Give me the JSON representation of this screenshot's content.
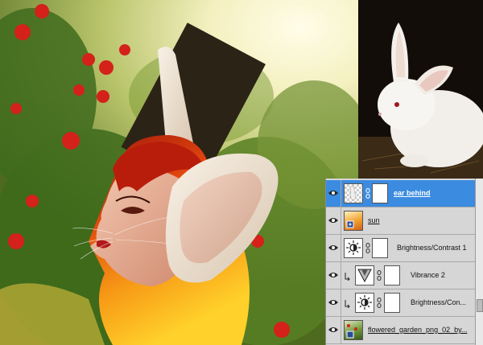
{
  "layers": [
    {
      "name": "ear behind",
      "selected": true,
      "has_mask": true,
      "clipped": false,
      "kind": "pixel-transparent"
    },
    {
      "name": "sun",
      "selected": false,
      "has_mask": false,
      "clipped": false,
      "kind": "pixel-sun"
    },
    {
      "name": "Brightness/Contrast 1",
      "selected": false,
      "has_mask": true,
      "clipped": false,
      "kind": "adjustment-brightness"
    },
    {
      "name": "Vibrance 2",
      "selected": false,
      "has_mask": true,
      "clipped": true,
      "kind": "adjustment-vibrance"
    },
    {
      "name": "Brightness/Con...",
      "selected": false,
      "has_mask": true,
      "clipped": true,
      "kind": "adjustment-brightness"
    },
    {
      "name": "flowered_garden_png_02_by...",
      "selected": false,
      "has_mask": false,
      "clipped": false,
      "kind": "pixel-garden"
    }
  ],
  "colors": {
    "selection": "#3b8be0",
    "panel_bg": "#d6d6d6"
  }
}
